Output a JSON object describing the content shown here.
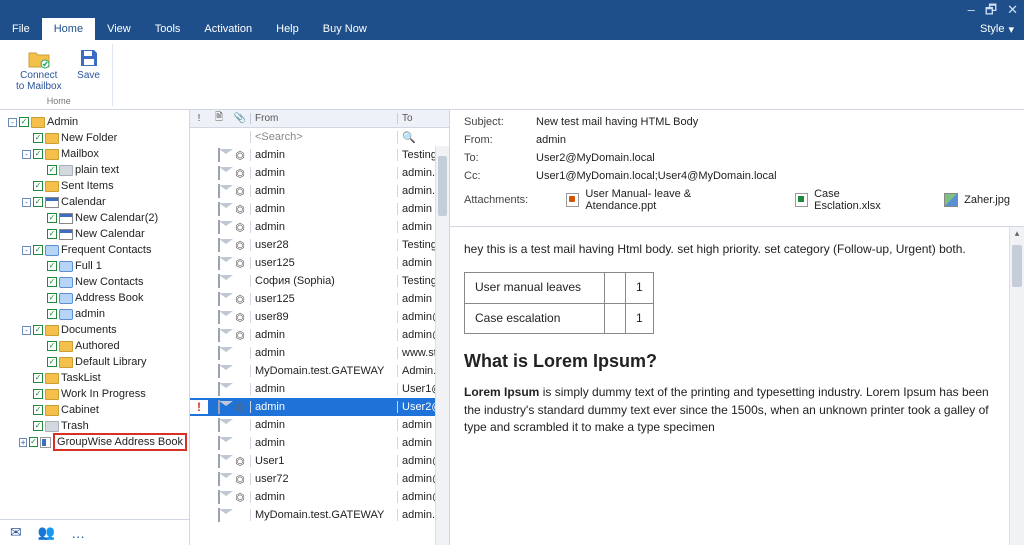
{
  "window": {
    "min": "–",
    "restore": "🗗",
    "close": "✕"
  },
  "menu": {
    "items": [
      "File",
      "Home",
      "View",
      "Tools",
      "Activation",
      "Help",
      "Buy Now"
    ],
    "active_index": 1,
    "style_label": "Style",
    "style_arrow": "▾"
  },
  "ribbon": {
    "group_label": "Home",
    "connect_label": "Connect\nto Mailbox",
    "save_label": "Save"
  },
  "tree": {
    "nodes": [
      {
        "depth": 0,
        "exp": "-",
        "chk": true,
        "ico": "folder",
        "label": "Admin"
      },
      {
        "depth": 1,
        "exp": "",
        "chk": true,
        "ico": "folder",
        "label": "New Folder"
      },
      {
        "depth": 1,
        "exp": "-",
        "chk": true,
        "ico": "folder",
        "label": "Mailbox"
      },
      {
        "depth": 2,
        "exp": "",
        "chk": true,
        "ico": "foldergrey",
        "label": "plain text"
      },
      {
        "depth": 1,
        "exp": "",
        "chk": true,
        "ico": "folder",
        "label": "Sent Items"
      },
      {
        "depth": 1,
        "exp": "-",
        "chk": true,
        "ico": "cal",
        "label": "Calendar"
      },
      {
        "depth": 2,
        "exp": "",
        "chk": true,
        "ico": "cal",
        "label": "New Calendar(2)"
      },
      {
        "depth": 2,
        "exp": "",
        "chk": true,
        "ico": "cal",
        "label": "New Calendar"
      },
      {
        "depth": 1,
        "exp": "-",
        "chk": true,
        "ico": "ppl",
        "label": "Frequent Contacts"
      },
      {
        "depth": 2,
        "exp": "",
        "chk": true,
        "ico": "ppl",
        "label": "Full 1"
      },
      {
        "depth": 2,
        "exp": "",
        "chk": true,
        "ico": "ppl",
        "label": "New Contacts"
      },
      {
        "depth": 2,
        "exp": "",
        "chk": true,
        "ico": "ppl",
        "label": "Address Book"
      },
      {
        "depth": 2,
        "exp": "",
        "chk": true,
        "ico": "ppl",
        "label": "admin"
      },
      {
        "depth": 1,
        "exp": "-",
        "chk": true,
        "ico": "folder",
        "label": "Documents"
      },
      {
        "depth": 2,
        "exp": "",
        "chk": true,
        "ico": "folder",
        "label": "Authored"
      },
      {
        "depth": 2,
        "exp": "",
        "chk": true,
        "ico": "folder",
        "label": "Default Library"
      },
      {
        "depth": 1,
        "exp": "",
        "chk": true,
        "ico": "folder",
        "label": "TaskList"
      },
      {
        "depth": 1,
        "exp": "",
        "chk": true,
        "ico": "folder",
        "label": "Work In Progress"
      },
      {
        "depth": 1,
        "exp": "",
        "chk": true,
        "ico": "folder",
        "label": "Cabinet"
      },
      {
        "depth": 1,
        "exp": "",
        "chk": true,
        "ico": "foldergrey",
        "label": "Trash"
      },
      {
        "depth": 1,
        "exp": "+",
        "chk": true,
        "ico": "ab",
        "label": "GroupWise Address Book",
        "highlight": true
      }
    ],
    "footer": {
      "mail": "✉",
      "people": "👥",
      "more": "…"
    }
  },
  "list": {
    "headers": {
      "bang": "!",
      "doc": "🗎",
      "clip": "📎",
      "from": "From",
      "to": "To"
    },
    "search_placeholder": "<Search>",
    "rows": [
      {
        "hp": "",
        "clip": "1",
        "from": "admin",
        "to": "Testing"
      },
      {
        "hp": "",
        "clip": "1",
        "from": "admin",
        "to": "admin.N"
      },
      {
        "hp": "",
        "clip": "1",
        "from": "admin",
        "to": "admin.N"
      },
      {
        "hp": "",
        "clip": "1",
        "from": "admin",
        "to": "admin"
      },
      {
        "hp": "",
        "clip": "1",
        "from": "admin",
        "to": "admin"
      },
      {
        "hp": "",
        "clip": "1",
        "from": "user28",
        "to": "Testing"
      },
      {
        "hp": "",
        "clip": "1",
        "from": "user125",
        "to": "admin"
      },
      {
        "hp": "",
        "clip": "",
        "from": "София (Sophia)",
        "to": "Testing"
      },
      {
        "hp": "",
        "clip": "1",
        "from": "user125",
        "to": "admin"
      },
      {
        "hp": "",
        "clip": "1",
        "from": "user89",
        "to": "admin@"
      },
      {
        "hp": "",
        "clip": "1",
        "from": "admin",
        "to": "admin@"
      },
      {
        "hp": "",
        "clip": "",
        "from": "admin",
        "to": "www.ste"
      },
      {
        "hp": "",
        "clip": "",
        "from": "MyDomain.test.GATEWAY",
        "to": "Admin.N"
      },
      {
        "hp": "",
        "clip": "",
        "from": "admin",
        "to": "User1@"
      },
      {
        "hp": "!",
        "clip": "1",
        "from": "admin",
        "to": "User2@",
        "selected": true
      },
      {
        "hp": "",
        "clip": "",
        "from": "admin",
        "to": "admin"
      },
      {
        "hp": "",
        "clip": "",
        "from": "admin",
        "to": "admin"
      },
      {
        "hp": "",
        "clip": "1",
        "from": "User1",
        "to": "admin@"
      },
      {
        "hp": "",
        "clip": "1",
        "from": "user72",
        "to": "admin@"
      },
      {
        "hp": "",
        "clip": "1",
        "from": "admin",
        "to": "admin@"
      },
      {
        "hp": "",
        "clip": "",
        "from": "MyDomain.test.GATEWAY",
        "to": "admin.N"
      }
    ]
  },
  "preview": {
    "labels": {
      "subject": "Subject:",
      "from": "From:",
      "to": "To:",
      "cc": "Cc:",
      "attachments": "Attachments:"
    },
    "subject": "New test mail having HTML Body",
    "from": "admin",
    "to": "User2@MyDomain.local",
    "cc": "User1@MyDomain.local;User4@MyDomain.local",
    "attachments": [
      {
        "type": "ppt",
        "name": "User Manual- leave & Atendance.ppt"
      },
      {
        "type": "xls",
        "name": "Case Esclation.xlsx"
      },
      {
        "type": "img",
        "name": "Zaher.jpg"
      }
    ],
    "body_intro": "hey this is a test mail having Html body.  set high priority.  set category (Follow-up, Urgent) both.",
    "table": {
      "r1c1": "User manual leaves",
      "r1c2": "",
      "r1c3": "1",
      "r2c1": "Case escalation",
      "r2c2": "",
      "r2c3": "1"
    },
    "body_h2": "What is Lorem Ipsum?",
    "body_para_strong": "Lorem Ipsum",
    "body_para_rest": " is simply dummy text of the printing and typesetting industry. Lorem Ipsum has been the industry's standard dummy text ever since the 1500s, when an unknown printer took a galley of type and scrambled it to make a type specimen"
  }
}
